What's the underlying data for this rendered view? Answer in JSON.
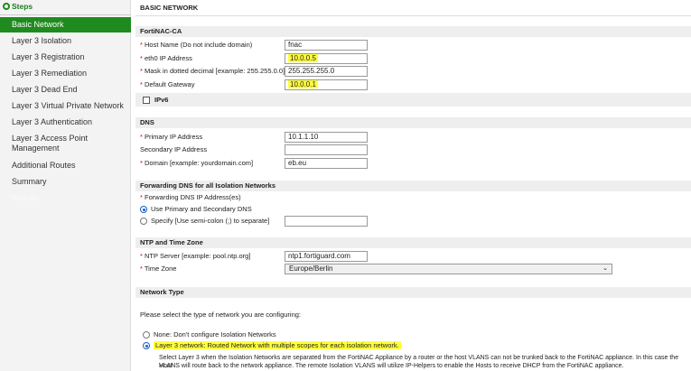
{
  "sidebar": {
    "header": "Steps",
    "items": [
      "Basic Network",
      "Layer 3 Isolation",
      "Layer 3 Registration",
      "Layer 3 Remediation",
      "Layer 3 Dead End",
      "Layer 3 Virtual Private Network",
      "Layer 3 Authentication",
      "Layer 3 Access Point Management",
      "Additional Routes",
      "Summary",
      "Results"
    ]
  },
  "page": {
    "title": "BASIC NETWORK"
  },
  "fortinac": {
    "header": "FortiNAC-CA",
    "host_label": "Host Name (Do not include domain)",
    "host_value": "fnac",
    "eth0_label": "eth0 IP Address",
    "eth0_value": "10.0.0.5",
    "mask_label": "Mask in dotted decimal [example: 255.255.0.0]",
    "mask_value": "255.255.255.0",
    "gw_label": "Default Gateway",
    "gw_value": "10.0.0.1",
    "ipv6_label": "IPv6"
  },
  "dns": {
    "header": "DNS",
    "primary_label": "Primary IP Address",
    "primary_value": "10.1.1.10",
    "secondary_label": "Secondary IP Address",
    "secondary_value": "",
    "domain_label": "Domain [example: yourdomain.com]",
    "domain_value": "eb.eu"
  },
  "fwd": {
    "header": "Forwarding DNS for all Isolation Networks",
    "label": "Forwarding DNS IP Address(es)",
    "opt1": "Use Primary and Secondary DNS",
    "opt2": "Specify [Use semi-colon (;) to separate]",
    "specify_value": ""
  },
  "ntp": {
    "header": "NTP and Time Zone",
    "server_label": "NTP Server [example: pool.ntp.org]",
    "server_value": "ntp1.fortiguard.com",
    "tz_label": "Time Zone",
    "tz_value": "Europe/Berlin"
  },
  "nettype": {
    "header": "Network Type",
    "prompt": "Please select the type of network you are configuring:",
    "opt_none": "None: Don't configure Isolation Networks",
    "opt_l3": "Layer 3 network: Routed Network with multiple scopes for each isolation network.",
    "desc1": "Select Layer 3 when the Isolation Networks are separated from the FortiNAC Appliance by a router or the host VLANS can not be trunked back to the FortiNAC appliance. In this case the Host",
    "desc2": "VLANS will route back to the network appliance. The remote Isolation VLANS will utilize IP-Helpers to enable the Hosts to receive DHCP from the FortiNAC appliance."
  },
  "colors": {
    "accent": "#1f8b1f",
    "highlight": "#ffff3c"
  }
}
